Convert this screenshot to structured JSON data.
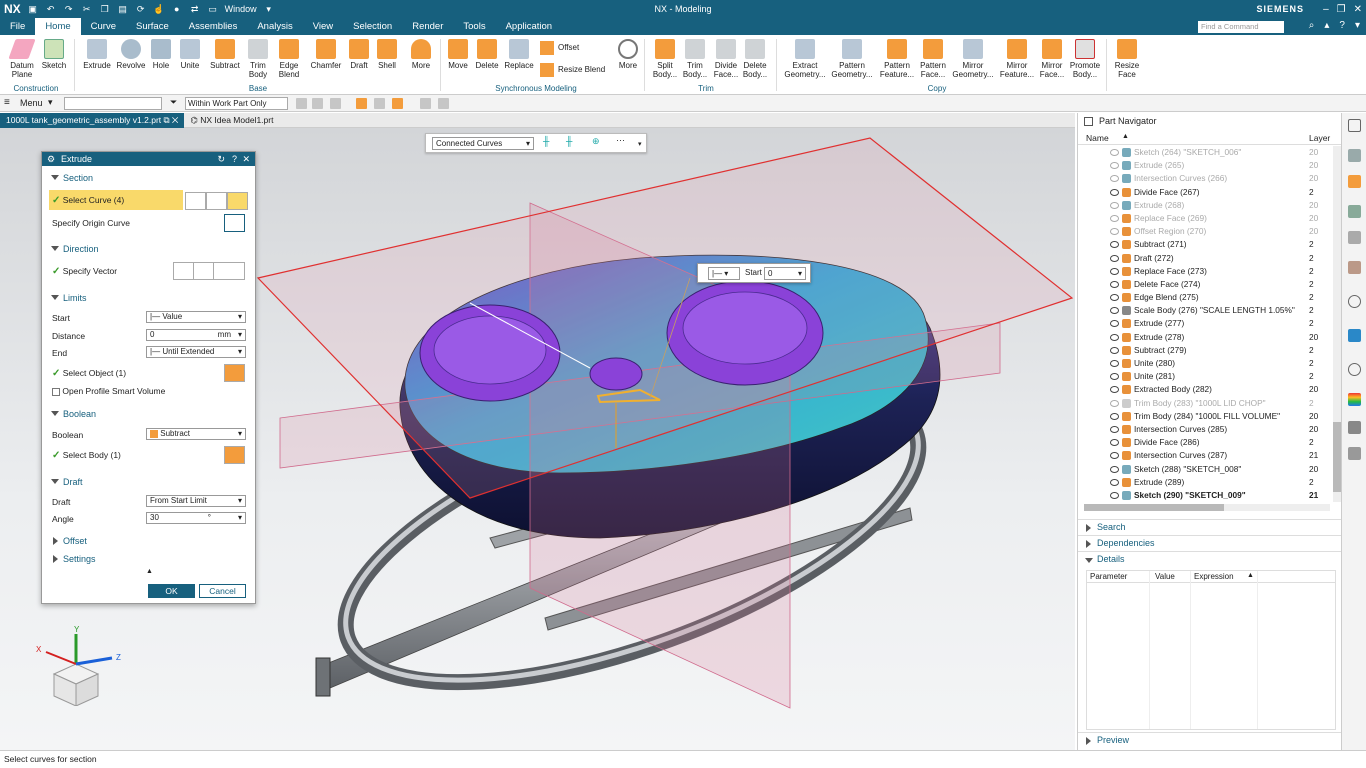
{
  "app": {
    "logo": "NX",
    "window_menu": "Window",
    "title": "NX - Modeling",
    "brand": "SIEMENS",
    "find_command_placeholder": "Find a Command"
  },
  "menu_tabs": [
    "File",
    "Home",
    "Curve",
    "Surface",
    "Assemblies",
    "Analysis",
    "View",
    "Selection",
    "Render",
    "Tools",
    "Application"
  ],
  "active_tab": "Home",
  "ribbon": {
    "construction": {
      "datum_plane": "Datum Plane",
      "sketch": "Sketch",
      "group": "Construction"
    },
    "base": {
      "extrude": "Extrude",
      "revolve": "Revolve",
      "hole": "Hole",
      "unite": "Unite",
      "subtract": "Subtract",
      "trim_body": "Trim Body",
      "edge_blend": "Edge Blend",
      "chamfer": "Chamfer",
      "draft": "Draft",
      "shell": "Shell",
      "more": "More",
      "group": "Base"
    },
    "sync": {
      "move": "Move",
      "delete": "Delete",
      "replace": "Replace",
      "offset": "Offset",
      "resize_blend": "Resize Blend",
      "more": "More",
      "group": "Synchronous Modeling"
    },
    "trim": {
      "split_body": "Split Body...",
      "trim_body": "Trim Body...",
      "divide_face": "Divide Face...",
      "delete_body": "Delete Body...",
      "group": "Trim"
    },
    "copy": {
      "extract_geometry": "Extract Geometry...",
      "pattern_geometry": "Pattern Geometry...",
      "pattern_feature": "Pattern Feature...",
      "pattern_face": "Pattern Face...",
      "mirror_geometry": "Mirror Geometry...",
      "mirror_feature": "Mirror Feature...",
      "mirror_face": "Mirror Face...",
      "promote_body": "Promote Body...",
      "group": "Copy"
    },
    "resize_face": "Resize Face"
  },
  "command_bar": {
    "menu": "Menu",
    "filter": "",
    "scope": "Within Work Part Only"
  },
  "doc_tabs": [
    "1000L tank_geometric_assembly v1.2.prt",
    "NX Idea Model1.prt"
  ],
  "selection_bar": {
    "curve_rule": "Connected Curves"
  },
  "start_popup": {
    "label": "Start",
    "value": "0"
  },
  "extrude_dialog": {
    "title": "Extrude",
    "section": {
      "header": "Section",
      "select_curve": "Select Curve (4)",
      "origin_curve": "Specify Origin Curve"
    },
    "direction": {
      "header": "Direction",
      "specify_vector": "Specify Vector"
    },
    "limits": {
      "header": "Limits",
      "start_label": "Start",
      "start_value": "Value",
      "distance_label": "Distance",
      "distance_value": "0",
      "distance_unit": "mm",
      "end_label": "End",
      "end_value": "Until Extended",
      "select_object": "Select Object (1)",
      "open_profile": "Open Profile Smart Volume"
    },
    "boolean": {
      "header": "Boolean",
      "boolean_label": "Boolean",
      "boolean_value": "Subtract",
      "select_body": "Select Body (1)"
    },
    "draft": {
      "header": "Draft",
      "draft_label": "Draft",
      "draft_value": "From Start Limit",
      "angle_label": "Angle",
      "angle_value": "30",
      "angle_unit": "°"
    },
    "offset": "Offset",
    "settings": "Settings",
    "ok": "OK",
    "cancel": "Cancel"
  },
  "triad": {
    "x": "X",
    "y": "Y",
    "z": "Z"
  },
  "part_navigator": {
    "title": "Part Navigator",
    "col_name": "Name",
    "col_layer": "Layer",
    "rows": [
      {
        "name": "Sketch (264) \"SKETCH_006\"",
        "layer": "20",
        "dim": true,
        "color": "#7ab"
      },
      {
        "name": "Extrude (265)",
        "layer": "20",
        "dim": true,
        "color": "#7ab"
      },
      {
        "name": "Intersection Curves (266)",
        "layer": "20",
        "dim": true,
        "color": "#7ab"
      },
      {
        "name": "Divide Face (267)",
        "layer": "2",
        "dim": false,
        "color": "#e8913a"
      },
      {
        "name": "Extrude (268)",
        "layer": "20",
        "dim": true,
        "color": "#7ab"
      },
      {
        "name": "Replace Face (269)",
        "layer": "20",
        "dim": true,
        "color": "#e8913a"
      },
      {
        "name": "Offset Region (270)",
        "layer": "20",
        "dim": true,
        "color": "#e8913a"
      },
      {
        "name": "Subtract (271)",
        "layer": "2",
        "dim": false,
        "color": "#e8913a"
      },
      {
        "name": "Draft (272)",
        "layer": "2",
        "dim": false,
        "color": "#e8913a"
      },
      {
        "name": "Replace Face (273)",
        "layer": "2",
        "dim": false,
        "color": "#e8913a"
      },
      {
        "name": "Delete Face (274)",
        "layer": "2",
        "dim": false,
        "color": "#e8913a"
      },
      {
        "name": "Edge Blend (275)",
        "layer": "2",
        "dim": false,
        "color": "#e8913a"
      },
      {
        "name": "Scale Body (276) \"SCALE LENGTH 1.05%\"",
        "layer": "2",
        "dim": false,
        "color": "#888"
      },
      {
        "name": "Extrude (277)",
        "layer": "2",
        "dim": false,
        "color": "#e8913a"
      },
      {
        "name": "Extrude (278)",
        "layer": "20",
        "dim": false,
        "color": "#e8913a"
      },
      {
        "name": "Subtract (279)",
        "layer": "2",
        "dim": false,
        "color": "#e8913a"
      },
      {
        "name": "Unite (280)",
        "layer": "2",
        "dim": false,
        "color": "#e8913a"
      },
      {
        "name": "Unite (281)",
        "layer": "2",
        "dim": false,
        "color": "#e8913a"
      },
      {
        "name": "Extracted Body (282)",
        "layer": "20",
        "dim": false,
        "color": "#e8913a"
      },
      {
        "name": "Trim Body (283) \"1000L LID CHOP\"",
        "layer": "2",
        "dim": true,
        "color": "#ccc"
      },
      {
        "name": "Trim Body (284) \"1000L FILL VOLUME\"",
        "layer": "20",
        "dim": false,
        "color": "#e8913a"
      },
      {
        "name": "Intersection Curves (285)",
        "layer": "20",
        "dim": false,
        "color": "#e8913a"
      },
      {
        "name": "Divide Face (286)",
        "layer": "2",
        "dim": false,
        "color": "#e8913a"
      },
      {
        "name": "Intersection Curves (287)",
        "layer": "21",
        "dim": false,
        "color": "#e8913a"
      },
      {
        "name": "Sketch (288) \"SKETCH_008\"",
        "layer": "20",
        "dim": false,
        "color": "#7ab"
      },
      {
        "name": "Extrude (289)",
        "layer": "2",
        "dim": false,
        "color": "#e8913a"
      },
      {
        "name": "Sketch (290) \"SKETCH_009\"",
        "layer": "21",
        "dim": false,
        "bold": true,
        "color": "#7ab"
      }
    ],
    "panels": {
      "search": "Search",
      "dependencies": "Dependencies",
      "details": "Details",
      "preview": "Preview"
    },
    "details_cols": [
      "Parameter",
      "Value",
      "Expression"
    ]
  },
  "status": "Select curves for section"
}
